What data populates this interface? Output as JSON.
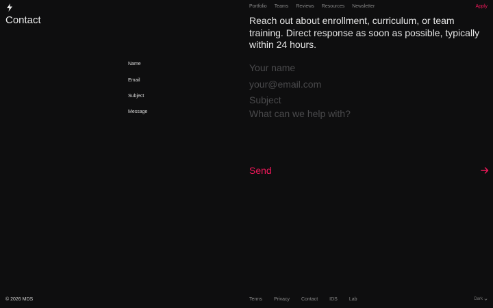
{
  "header": {
    "logo_icon": "lightning-bolt-icon",
    "nav": [
      "Portfolio",
      "Teams",
      "Reviews",
      "Resources",
      "Newsletter"
    ],
    "apply_label": "Apply",
    "accent_color": "#f0185a"
  },
  "page": {
    "title": "Contact",
    "intro": "Reach out about enrollment, curriculum, or team training. Direct response as soon as possible, typically within 24 hours."
  },
  "form": {
    "name_label": "Name",
    "name_placeholder": "Your name",
    "name_value": "",
    "email_label": "Email",
    "email_placeholder": "your@email.com",
    "email_value": "",
    "subject_label": "Subject",
    "subject_placeholder": "Subject",
    "subject_value": "",
    "message_label": "Message",
    "message_placeholder": "What can we help with?",
    "message_value": "",
    "send_label": "Send",
    "send_icon": "arrow-right-icon"
  },
  "footer": {
    "copyright": "© 2026 MDS",
    "links": [
      "Terms",
      "Privacy",
      "Contact",
      "IDS",
      "Lab"
    ],
    "theme_value": "Dark",
    "theme_icon": "chevron-down-icon"
  }
}
